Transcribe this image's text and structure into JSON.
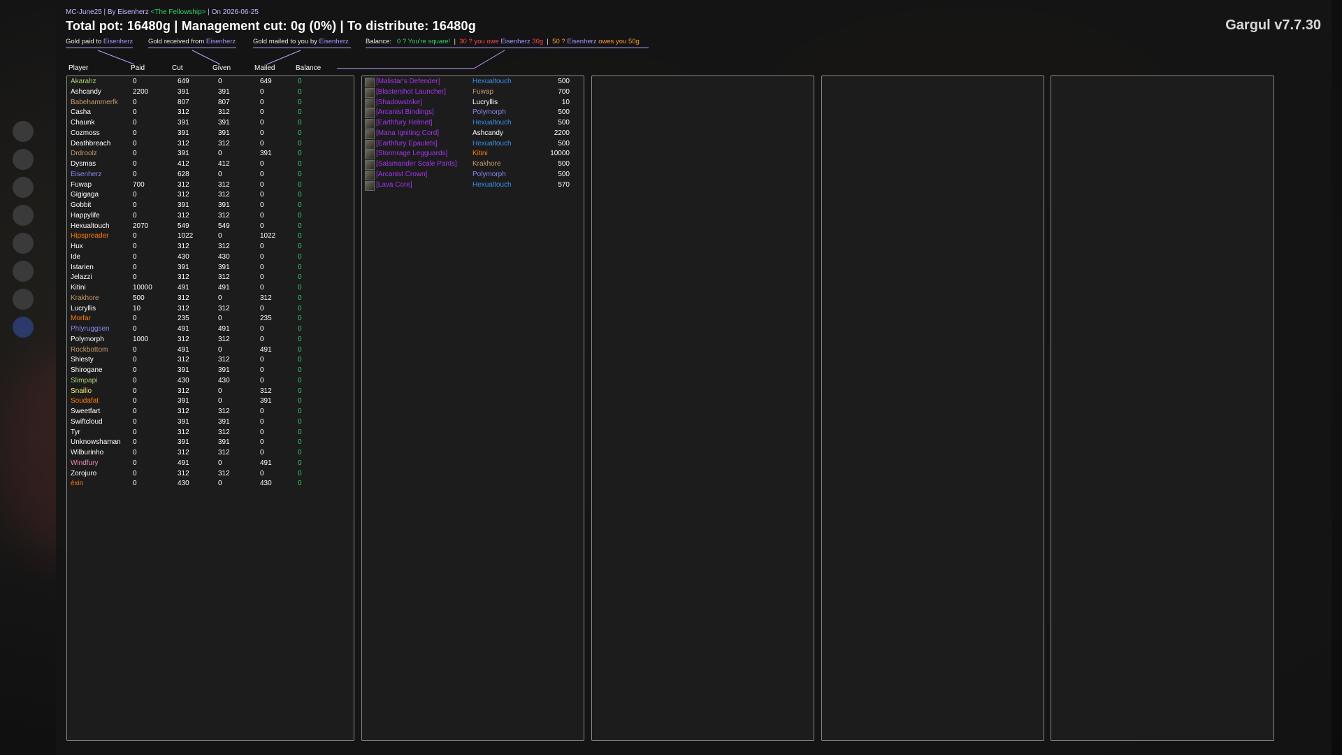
{
  "header": {
    "meta_prefix": "MC-June25 | By Eisenherz ",
    "guild": "<The Fellowship>",
    "meta_suffix": " | On 2026-06-25",
    "total_line": "Total pot: 16480g | Management cut: 0g (0%) | To distribute: 16480g",
    "version": "Gargul v7.7.30"
  },
  "legend": {
    "paid_label": "Gold paid to ",
    "paid_name": "Eisenherz",
    "received_label": "Gold received from ",
    "received_name": "Eisenherz",
    "mailed_label": "Gold mailed to you by ",
    "mailed_name": "Eisenherz",
    "balance_label": "Balance:",
    "square": "0 ? You're square!",
    "owe_pre": "30 ? you owe ",
    "owe_name": "Eisenherz",
    "owe_amt": " 30g",
    "owes_pre": "50 ? ",
    "owes_name": "Eisenherz",
    "owes_post": " owes you 50g",
    "sep": "|"
  },
  "columns": {
    "player": "Player",
    "paid": "Paid",
    "cut": "Cut",
    "given": "Given",
    "mailed": "Mailed",
    "balance": "Balance"
  },
  "colors": {
    "druid": "#ff7c0a",
    "hunter": "#aad372",
    "mage": "#3fc7eb",
    "paladin": "#f48cba",
    "priest": "#ffffff",
    "rogue": "#fff468",
    "shaman": "#0070dd",
    "warlock": "#8788ee",
    "warrior": "#c69b6d",
    "epic": "#a335ee",
    "balance": "#34d06b"
  },
  "players": [
    {
      "name": "Akarahz",
      "cls": "hunter",
      "paid": "0",
      "cut": "649",
      "given": "0",
      "mailed": "649",
      "balance": "0"
    },
    {
      "name": "Ashcandy",
      "cls": "priest",
      "paid": "2200",
      "cut": "391",
      "given": "391",
      "mailed": "0",
      "balance": "0"
    },
    {
      "name": "Babehammerfk",
      "cls": "warrior",
      "paid": "0",
      "cut": "807",
      "given": "807",
      "mailed": "0",
      "balance": "0"
    },
    {
      "name": "Casha",
      "cls": "priest",
      "paid": "0",
      "cut": "312",
      "given": "312",
      "mailed": "0",
      "balance": "0"
    },
    {
      "name": "Chaunk",
      "cls": "priest",
      "paid": "0",
      "cut": "391",
      "given": "391",
      "mailed": "0",
      "balance": "0"
    },
    {
      "name": "Cozmoss",
      "cls": "priest",
      "paid": "0",
      "cut": "391",
      "given": "391",
      "mailed": "0",
      "balance": "0"
    },
    {
      "name": "Deathbreach",
      "cls": "priest",
      "paid": "0",
      "cut": "312",
      "given": "312",
      "mailed": "0",
      "balance": "0"
    },
    {
      "name": "Drdroolz",
      "cls": "warrior",
      "paid": "0",
      "cut": "391",
      "given": "0",
      "mailed": "391",
      "balance": "0"
    },
    {
      "name": "Dysmas",
      "cls": "priest",
      "paid": "0",
      "cut": "412",
      "given": "412",
      "mailed": "0",
      "balance": "0"
    },
    {
      "name": "Eisenherz",
      "cls": "warlock",
      "paid": "0",
      "cut": "628",
      "given": "0",
      "mailed": "0",
      "balance": "0"
    },
    {
      "name": "Fuwap",
      "cls": "priest",
      "paid": "700",
      "cut": "312",
      "given": "312",
      "mailed": "0",
      "balance": "0"
    },
    {
      "name": "Gigigaga",
      "cls": "priest",
      "paid": "0",
      "cut": "312",
      "given": "312",
      "mailed": "0",
      "balance": "0"
    },
    {
      "name": "Gobbit",
      "cls": "priest",
      "paid": "0",
      "cut": "391",
      "given": "391",
      "mailed": "0",
      "balance": "0"
    },
    {
      "name": "Happylife",
      "cls": "priest",
      "paid": "0",
      "cut": "312",
      "given": "312",
      "mailed": "0",
      "balance": "0"
    },
    {
      "name": "Hexualtouch",
      "cls": "priest",
      "paid": "2070",
      "cut": "549",
      "given": "549",
      "mailed": "0",
      "balance": "0"
    },
    {
      "name": "Hipspreader",
      "cls": "druid",
      "paid": "0",
      "cut": "1022",
      "given": "0",
      "mailed": "1022",
      "balance": "0"
    },
    {
      "name": "Hux",
      "cls": "priest",
      "paid": "0",
      "cut": "312",
      "given": "312",
      "mailed": "0",
      "balance": "0"
    },
    {
      "name": "Ide",
      "cls": "priest",
      "paid": "0",
      "cut": "430",
      "given": "430",
      "mailed": "0",
      "balance": "0"
    },
    {
      "name": "Istarien",
      "cls": "priest",
      "paid": "0",
      "cut": "391",
      "given": "391",
      "mailed": "0",
      "balance": "0"
    },
    {
      "name": "Jelazzi",
      "cls": "priest",
      "paid": "0",
      "cut": "312",
      "given": "312",
      "mailed": "0",
      "balance": "0"
    },
    {
      "name": "Kitini",
      "cls": "priest",
      "paid": "10000",
      "cut": "491",
      "given": "491",
      "mailed": "0",
      "balance": "0"
    },
    {
      "name": "Krakhore",
      "cls": "warrior",
      "paid": "500",
      "cut": "312",
      "given": "0",
      "mailed": "312",
      "balance": "0"
    },
    {
      "name": "Lucryllis",
      "cls": "priest",
      "paid": "10",
      "cut": "312",
      "given": "312",
      "mailed": "0",
      "balance": "0"
    },
    {
      "name": "Morfar",
      "cls": "druid",
      "paid": "0",
      "cut": "235",
      "given": "0",
      "mailed": "235",
      "balance": "0"
    },
    {
      "name": "Phlyruggsen",
      "cls": "warlock",
      "paid": "0",
      "cut": "491",
      "given": "491",
      "mailed": "0",
      "balance": "0"
    },
    {
      "name": "Polymorph",
      "cls": "priest",
      "paid": "1000",
      "cut": "312",
      "given": "312",
      "mailed": "0",
      "balance": "0"
    },
    {
      "name": "Rockbottom",
      "cls": "warrior",
      "paid": "0",
      "cut": "491",
      "given": "0",
      "mailed": "491",
      "balance": "0"
    },
    {
      "name": "Shiesty",
      "cls": "priest",
      "paid": "0",
      "cut": "312",
      "given": "312",
      "mailed": "0",
      "balance": "0"
    },
    {
      "name": "Shirogane",
      "cls": "priest",
      "paid": "0",
      "cut": "391",
      "given": "391",
      "mailed": "0",
      "balance": "0"
    },
    {
      "name": "Slimpapi",
      "cls": "hunter",
      "paid": "0",
      "cut": "430",
      "given": "430",
      "mailed": "0",
      "balance": "0"
    },
    {
      "name": "Snailio",
      "cls": "rogue",
      "paid": "0",
      "cut": "312",
      "given": "0",
      "mailed": "312",
      "balance": "0"
    },
    {
      "name": "Soudafat",
      "cls": "druid",
      "paid": "0",
      "cut": "391",
      "given": "0",
      "mailed": "391",
      "balance": "0"
    },
    {
      "name": "Sweetfart",
      "cls": "priest",
      "paid": "0",
      "cut": "312",
      "given": "312",
      "mailed": "0",
      "balance": "0"
    },
    {
      "name": "Swiftcloud",
      "cls": "priest",
      "paid": "0",
      "cut": "391",
      "given": "391",
      "mailed": "0",
      "balance": "0"
    },
    {
      "name": "Tyr",
      "cls": "priest",
      "paid": "0",
      "cut": "312",
      "given": "312",
      "mailed": "0",
      "balance": "0"
    },
    {
      "name": "Unknowshaman",
      "cls": "priest",
      "paid": "0",
      "cut": "391",
      "given": "391",
      "mailed": "0",
      "balance": "0"
    },
    {
      "name": "Wilburinho",
      "cls": "priest",
      "paid": "0",
      "cut": "312",
      "given": "312",
      "mailed": "0",
      "balance": "0"
    },
    {
      "name": "Windfury",
      "cls": "paladin",
      "paid": "0",
      "cut": "491",
      "given": "0",
      "mailed": "491",
      "balance": "0"
    },
    {
      "name": "Zorojuro",
      "cls": "priest",
      "paid": "0",
      "cut": "312",
      "given": "312",
      "mailed": "0",
      "balance": "0"
    },
    {
      "name": "éxin",
      "cls": "druid",
      "paid": "0",
      "cut": "430",
      "given": "0",
      "mailed": "430",
      "balance": "0"
    }
  ],
  "items": [
    {
      "item": "[Malistar's Defender]",
      "winner": "Hexualtouch",
      "cls": "shaman",
      "amount": "500",
      "icon": "shield-icon"
    },
    {
      "item": "[Blastershot Launcher]",
      "winner": "Fuwap",
      "cls": "warrior",
      "amount": "700",
      "icon": "gun-icon"
    },
    {
      "item": "[Shadowstrike]",
      "winner": "Lucryllis",
      "cls": "priest",
      "amount": "10",
      "icon": "polearm-icon"
    },
    {
      "item": "[Arcanist Bindings]",
      "winner": "Polymorph",
      "cls": "warlock",
      "amount": "500",
      "icon": "bracer-icon"
    },
    {
      "item": "[Earthfury Helmet]",
      "winner": "Hexualtouch",
      "cls": "shaman",
      "amount": "500",
      "icon": "helmet-icon"
    },
    {
      "item": "[Mana Igniting Cord]",
      "winner": "Ashcandy",
      "cls": "priest",
      "amount": "2200",
      "icon": "belt-icon"
    },
    {
      "item": "[Earthfury Epaulets]",
      "winner": "Hexualtouch",
      "cls": "shaman",
      "amount": "500",
      "icon": "shoulder-icon"
    },
    {
      "item": "[Stormrage Legguards]",
      "winner": "Kitini",
      "cls": "druid",
      "amount": "10000",
      "icon": "legs-icon"
    },
    {
      "item": "[Salamander Scale Pants]",
      "winner": "Krakhore",
      "cls": "warrior",
      "amount": "500",
      "icon": "pants-icon"
    },
    {
      "item": "[Arcanist Crown]",
      "winner": "Polymorph",
      "cls": "warlock",
      "amount": "500",
      "icon": "crown-icon"
    },
    {
      "item": "[Lava Core]",
      "winner": "Hexualtouch",
      "cls": "shaman",
      "amount": "570",
      "icon": "core-icon"
    }
  ],
  "item_colors": {
    "Hexualtouch": "#3a8ee8",
    "Fuwap": "#c69b6d",
    "Lucryllis": "#ffffff",
    "Polymorph": "#8788ee",
    "Ashcandy": "#ffffff",
    "Kitini": "#ff7c0a",
    "Krakhore": "#c69b6d"
  }
}
